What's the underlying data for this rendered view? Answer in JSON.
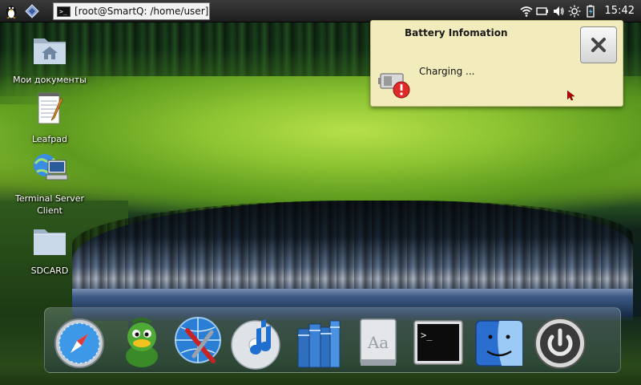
{
  "panel": {
    "start_icon": "tux-penguin-icon",
    "second_icon": "diamond-launcher-icon",
    "task": {
      "label": "[root@SmartQ: /home/user]",
      "icon": "terminal-icon"
    },
    "tray_icons": [
      "wifi-icon",
      "battery-icon",
      "volume-icon",
      "brightness-icon",
      "battery-charging-icon"
    ],
    "clock": "15:42"
  },
  "desktop": {
    "icons": [
      {
        "label": "Мои документы",
        "icon": "home-folder-icon"
      },
      {
        "label": "Leafpad",
        "icon": "notepad-icon"
      },
      {
        "label": "Terminal Server Client",
        "icon": "remote-desktop-icon"
      },
      {
        "label": "SDCARD",
        "icon": "folder-icon"
      }
    ]
  },
  "popup": {
    "title": "Battery Infomation",
    "message": "Charging ...",
    "icon": "battery-warning-icon",
    "close_icon": "close-x-icon"
  },
  "dock": {
    "items": [
      {
        "icon": "safari-compass-icon"
      },
      {
        "icon": "adium-duck-icon"
      },
      {
        "icon": "network-tools-icon"
      },
      {
        "icon": "itunes-music-icon"
      },
      {
        "icon": "books-library-icon"
      },
      {
        "icon": "dictionary-icon"
      },
      {
        "icon": "terminal-icon"
      },
      {
        "icon": "finder-icon"
      },
      {
        "icon": "power-icon"
      }
    ]
  },
  "colors": {
    "popup_bg": "#f2ecbc",
    "panel_bg": "#2a2a2a",
    "accent_blue": "#2a7fd4"
  }
}
